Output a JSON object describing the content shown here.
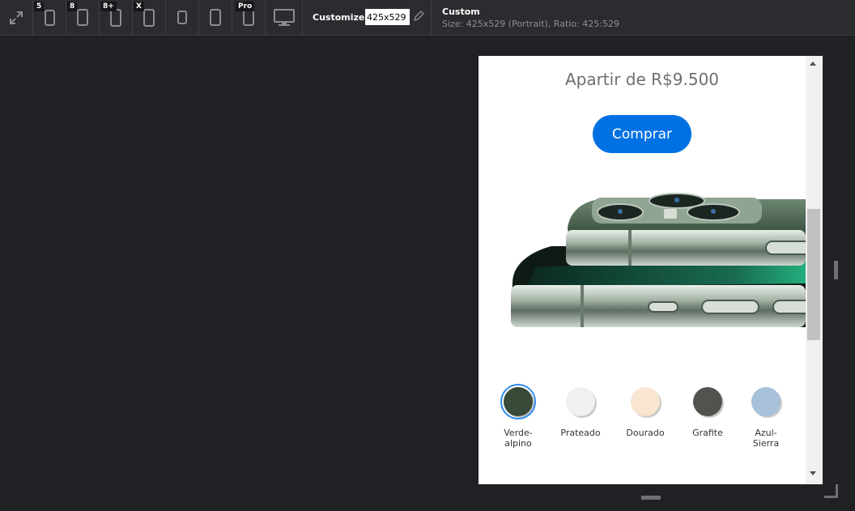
{
  "toolbar": {
    "devices": [
      {
        "name": "fit",
        "badge": ""
      },
      {
        "name": "device-5",
        "badge": "5"
      },
      {
        "name": "device-8",
        "badge": "8"
      },
      {
        "name": "device-8plus",
        "badge": "8+"
      },
      {
        "name": "device-x",
        "badge": "X"
      },
      {
        "name": "device-tablet-small",
        "badge": ""
      },
      {
        "name": "device-tablet",
        "badge": ""
      },
      {
        "name": "device-pro",
        "badge": "Pro"
      },
      {
        "name": "device-desktop",
        "badge": ""
      }
    ],
    "customize_label": "Customize:",
    "size_value": "425x529",
    "custom_title": "Custom",
    "custom_info": "Size: 425x529 (Portrait), Ratio: 425:529"
  },
  "page": {
    "price": "Apartir de R$9.500",
    "buy_label": "Comprar",
    "colors": [
      {
        "label": "Verde-\nalpino",
        "color": "#394a38",
        "selected": true
      },
      {
        "label": "Prateado",
        "color": "#f0f0ee",
        "selected": false
      },
      {
        "label": "Dourado",
        "color": "#f8e6d1",
        "selected": false
      },
      {
        "label": "Grafite",
        "color": "#54524f",
        "selected": false
      },
      {
        "label": "Azul-\nSierra",
        "color": "#a7c1d9",
        "selected": false
      }
    ]
  },
  "colors": {
    "accent": "#0071e3",
    "selection_ring": "#2e8cf0",
    "app_bg": "#202124",
    "toolbar_bg": "#2b2c2f"
  }
}
